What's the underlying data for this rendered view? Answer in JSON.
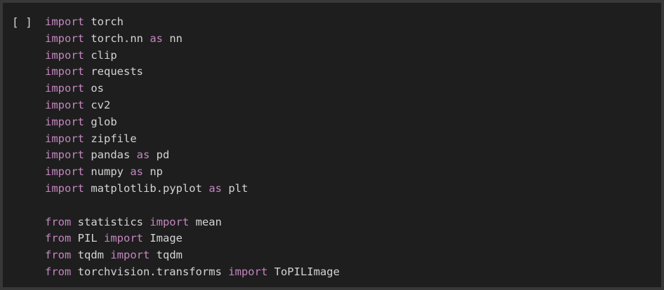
{
  "cell": {
    "run_indicator": "[ ]",
    "lines": [
      [
        {
          "t": "import",
          "k": "kw"
        },
        {
          "t": " torch",
          "k": "tx"
        }
      ],
      [
        {
          "t": "import",
          "k": "kw"
        },
        {
          "t": " torch.nn ",
          "k": "tx"
        },
        {
          "t": "as",
          "k": "kw"
        },
        {
          "t": " nn",
          "k": "tx"
        }
      ],
      [
        {
          "t": "import",
          "k": "kw"
        },
        {
          "t": " clip",
          "k": "tx"
        }
      ],
      [
        {
          "t": "import",
          "k": "kw"
        },
        {
          "t": " requests",
          "k": "tx"
        }
      ],
      [
        {
          "t": "import",
          "k": "kw"
        },
        {
          "t": " os",
          "k": "tx"
        }
      ],
      [
        {
          "t": "import",
          "k": "kw"
        },
        {
          "t": " cv2",
          "k": "tx"
        }
      ],
      [
        {
          "t": "import",
          "k": "kw"
        },
        {
          "t": " glob",
          "k": "tx"
        }
      ],
      [
        {
          "t": "import",
          "k": "kw"
        },
        {
          "t": " zipfile",
          "k": "tx"
        }
      ],
      [
        {
          "t": "import",
          "k": "kw"
        },
        {
          "t": " pandas ",
          "k": "tx"
        },
        {
          "t": "as",
          "k": "kw"
        },
        {
          "t": " pd",
          "k": "tx"
        }
      ],
      [
        {
          "t": "import",
          "k": "kw"
        },
        {
          "t": " numpy ",
          "k": "tx"
        },
        {
          "t": "as",
          "k": "kw"
        },
        {
          "t": " np",
          "k": "tx"
        }
      ],
      [
        {
          "t": "import",
          "k": "kw"
        },
        {
          "t": " matplotlib.pyplot ",
          "k": "tx"
        },
        {
          "t": "as",
          "k": "kw"
        },
        {
          "t": " plt",
          "k": "tx"
        }
      ],
      [],
      [
        {
          "t": "from",
          "k": "kw"
        },
        {
          "t": " statistics ",
          "k": "tx"
        },
        {
          "t": "import",
          "k": "kw"
        },
        {
          "t": " mean",
          "k": "tx"
        }
      ],
      [
        {
          "t": "from",
          "k": "kw"
        },
        {
          "t": " PIL ",
          "k": "tx"
        },
        {
          "t": "import",
          "k": "kw"
        },
        {
          "t": " Image",
          "k": "tx"
        }
      ],
      [
        {
          "t": "from",
          "k": "kw"
        },
        {
          "t": " tqdm ",
          "k": "tx"
        },
        {
          "t": "import",
          "k": "kw"
        },
        {
          "t": " tqdm",
          "k": "tx"
        }
      ],
      [
        {
          "t": "from",
          "k": "kw"
        },
        {
          "t": " torchvision.transforms ",
          "k": "tx"
        },
        {
          "t": "import",
          "k": "kw"
        },
        {
          "t": " ToPILImage",
          "k": "tx"
        }
      ]
    ]
  }
}
